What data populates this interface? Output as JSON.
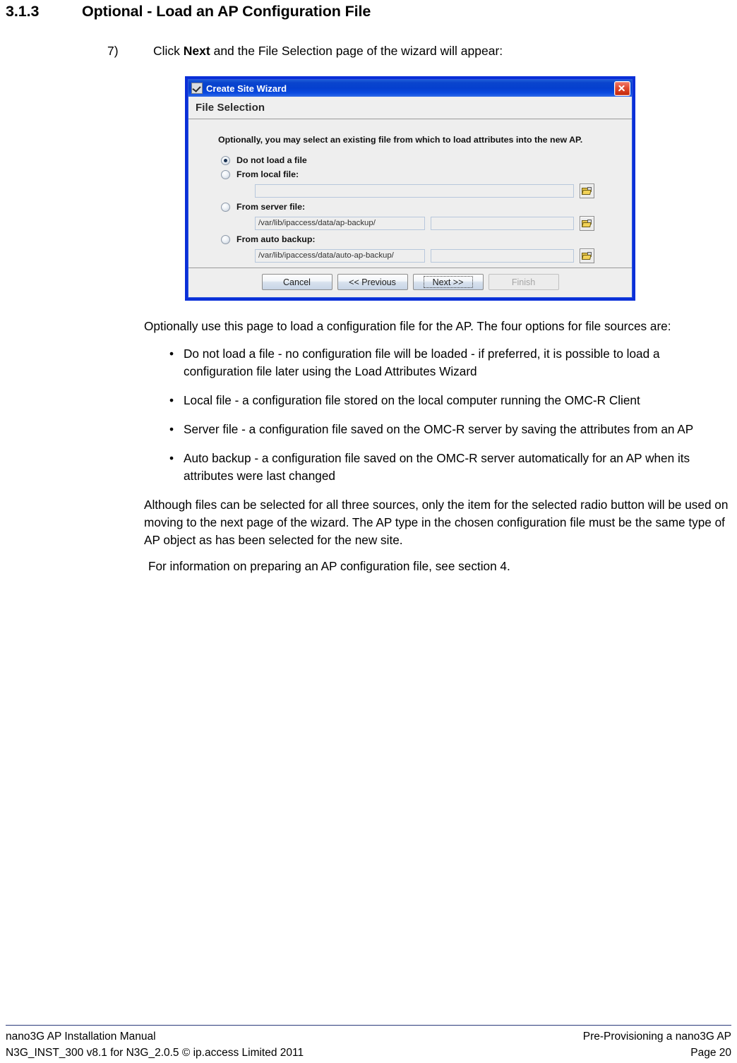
{
  "heading": {
    "number": "3.1.3",
    "title": "Optional - Load an AP Configuration File"
  },
  "step": {
    "number": "7)",
    "text_before": "Click ",
    "bold": "Next",
    "text_after": " and the File Selection page of the wizard will appear:"
  },
  "dialog": {
    "title": "Create Site Wizard",
    "title_icon": "wizard-icon",
    "close_icon": "close-icon",
    "page_header": "File Selection",
    "intro": "Optionally, you may select an existing file from which to load attributes into the new AP.",
    "options": [
      {
        "id": "do-not-load",
        "label": "Do not load a file",
        "selected": true,
        "fields": []
      },
      {
        "id": "from-local-file",
        "label": "From local file:",
        "selected": false,
        "fields": [
          {
            "value": "",
            "width": "wide"
          }
        ],
        "browse_icon": "open-folder-icon"
      },
      {
        "id": "from-server-file",
        "label": "From server file:",
        "selected": false,
        "fields": [
          {
            "value": "/var/lib/ipaccess/data/ap-backup/",
            "width": "half-a"
          },
          {
            "value": "",
            "width": "half-b"
          }
        ],
        "browse_icon": "open-folder-icon"
      },
      {
        "id": "from-auto-backup",
        "label": "From auto backup:",
        "selected": false,
        "fields": [
          {
            "value": "/var/lib/ipaccess/data/auto-ap-backup/",
            "width": "half-a"
          },
          {
            "value": "",
            "width": "half-b"
          }
        ],
        "browse_icon": "open-folder-icon"
      }
    ],
    "buttons": [
      {
        "id": "cancel",
        "label": "Cancel",
        "state": "normal"
      },
      {
        "id": "previous",
        "label": "<< Previous",
        "state": "normal"
      },
      {
        "id": "next",
        "label": "Next >>",
        "state": "focused"
      },
      {
        "id": "finish",
        "label": "Finish",
        "state": "disabled"
      }
    ],
    "colors": {
      "titlebar": "#0540cf",
      "border": "#0a2fd8",
      "close_button": "#c32708",
      "body": "#eeeeee"
    }
  },
  "body": {
    "intro_paragraph": "Optionally use this page to load a configuration file for the AP. The four options for file sources are:",
    "bullet_marker": "•",
    "bullets": [
      "Do not load a file - no configuration file will be loaded - if preferred, it is possible to load a configuration file later using the Load Attributes Wizard",
      "Local file - a configuration file stored on the local computer running the OMC-R Client",
      "Server file - a configuration file saved on the OMC-R server by saving the attributes from an AP",
      "Auto backup - a configuration file saved on the OMC-R server automatically for an AP when its attributes were last changed"
    ],
    "paragraph_2": "Although files can be selected for all three sources, only the item for the selected radio button will be used on moving to the next page of the wizard. The AP type in the chosen configuration file must be the same type of AP object as has been selected for the new site.",
    "paragraph_3": " For information on preparing an AP configuration file, see section 4."
  },
  "footer": {
    "left_line1": "nano3G AP Installation Manual",
    "left_line2": "N3G_INST_300 v8.1 for N3G_2.0.5 © ip.access Limited 2011",
    "right_line1": "Pre-Provisioning a nano3G AP",
    "right_line2": "Page 20"
  }
}
